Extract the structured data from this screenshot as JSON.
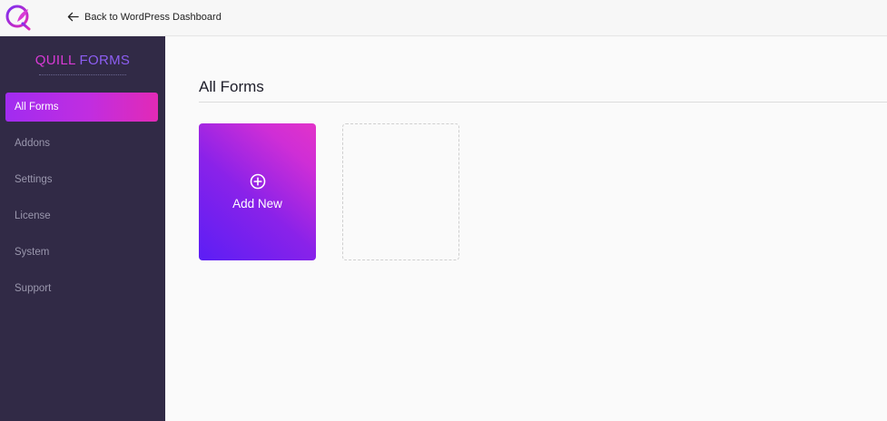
{
  "topbar": {
    "back_label": "Back to WordPress Dashboard",
    "logo_icon": "quill-forms-logo-icon",
    "back_icon": "arrow-left-icon"
  },
  "sidebar": {
    "brand": {
      "word1": "QUILL",
      "word2": "FORMS"
    },
    "items": [
      {
        "label": "All Forms",
        "active": true
      },
      {
        "label": "Addons",
        "active": false
      },
      {
        "label": "Settings",
        "active": false
      },
      {
        "label": "License",
        "active": false
      },
      {
        "label": "System",
        "active": false
      },
      {
        "label": "Support",
        "active": false
      }
    ]
  },
  "main": {
    "title": "All Forms",
    "add_new": {
      "label": "Add New",
      "icon": "plus-circle-icon"
    }
  },
  "colors": {
    "sidebar_bg": "#312a46",
    "accent_pink": "#e22ab6",
    "accent_purple": "#5b1ef5",
    "brand_word1": "#d93ad6",
    "brand_word2": "#8d5ef2"
  }
}
